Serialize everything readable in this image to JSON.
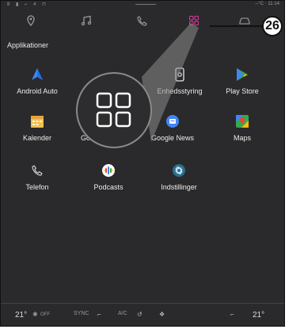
{
  "statusbar": {
    "left": "8 ▮ ⌐ 4 ⊓",
    "time": "--°C · 11:14"
  },
  "nav": [
    {
      "icon": "location-pin-icon"
    },
    {
      "icon": "music-icon"
    },
    {
      "icon": "phone-icon"
    },
    {
      "icon": "apps-grid-icon"
    },
    {
      "icon": "car-icon"
    }
  ],
  "section_title": "Applikationer",
  "apps": [
    {
      "label": "Android Auto",
      "icon": "android-auto-icon"
    },
    {
      "label": "Enhedsstyring",
      "icon": "device-manager-icon"
    },
    {
      "label": "Play Store",
      "icon": "play-store-icon"
    },
    {
      "label": "Kalender",
      "icon": "calendar-icon"
    },
    {
      "label": "Google- assistent",
      "icon": "google-assistant-icon"
    },
    {
      "label": "Google News",
      "icon": "google-news-icon"
    },
    {
      "label": "Maps",
      "icon": "maps-icon"
    },
    {
      "label": "Telefon",
      "icon": "phone-icon"
    },
    {
      "label": "Podcasts",
      "icon": "podcasts-icon"
    },
    {
      "label": "Indstillinger",
      "icon": "settings-gear-icon"
    }
  ],
  "callout_number": "26",
  "bottom": {
    "temp_left": "21°",
    "off_label": "OFF",
    "sync": "SYNC",
    "ac": "A/C",
    "temp_right": "21°"
  }
}
